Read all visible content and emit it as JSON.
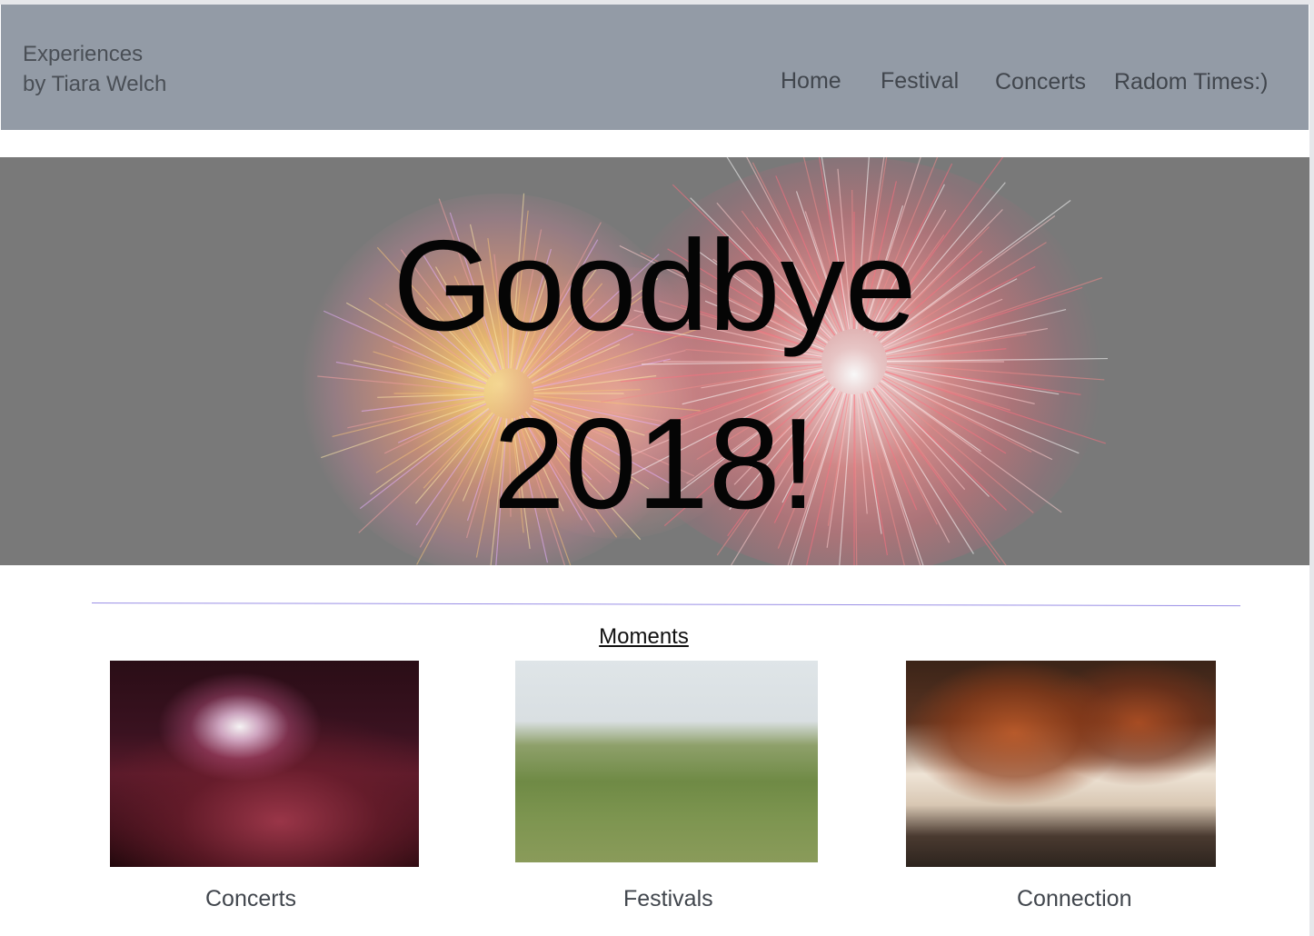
{
  "header": {
    "brand_line1": "Experiences",
    "brand_line2": "by Tiara Welch",
    "background_color": "#939ba6",
    "nav": [
      {
        "label": "Home"
      },
      {
        "label": "Festival"
      },
      {
        "label": "Concerts"
      },
      {
        "label": "Radom Times:)"
      }
    ]
  },
  "hero": {
    "title_line1": "Goodbye",
    "title_line2": "2018!",
    "background_image": "fireworks"
  },
  "moments": {
    "heading": "Moments",
    "divider_color": "#9a8fe6",
    "cards": [
      {
        "label": "Concerts",
        "image": "concert-arena-photo"
      },
      {
        "label": "Festivals",
        "image": "festival-lawn-photo"
      },
      {
        "label": "Connection",
        "image": "autumn-bridge-photo"
      }
    ]
  }
}
